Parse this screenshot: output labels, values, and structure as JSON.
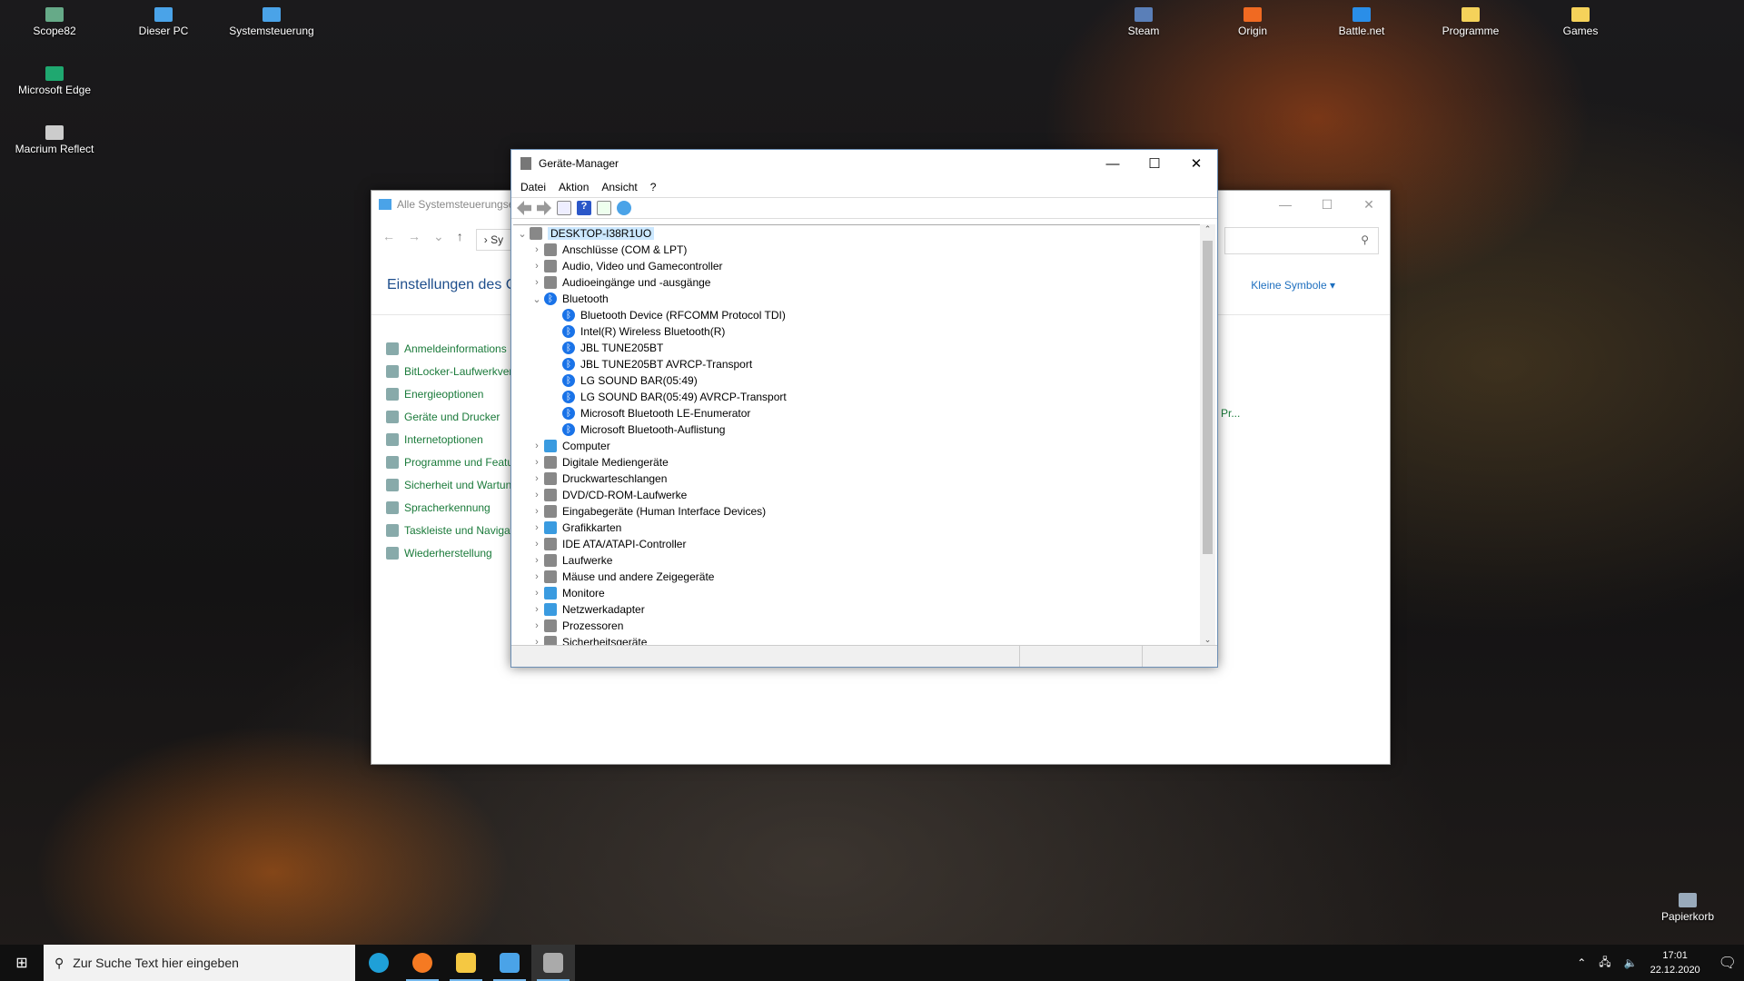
{
  "desktop": {
    "icons": [
      {
        "label": "Scope82",
        "color": "#6a8"
      },
      {
        "label": "Dieser PC",
        "color": "#4aa3e8"
      },
      {
        "label": "Systemsteuerung",
        "color": "#4aa3e8"
      },
      {
        "label": "Microsoft Edge",
        "color": "#1fa870"
      },
      {
        "label": "Macrium Reflect",
        "color": "#ccc"
      },
      {
        "label": "Steam",
        "color": "#5a7fb8"
      },
      {
        "label": "Origin",
        "color": "#f06a22"
      },
      {
        "label": "Battle.net",
        "color": "#2a8ee8"
      },
      {
        "label": "Programme",
        "color": "#f5d25a"
      },
      {
        "label": "Games",
        "color": "#f5d25a"
      },
      {
        "label": "Papierkorb",
        "color": "#9ab"
      }
    ]
  },
  "control_panel": {
    "title": "Alle Systemsteuerungse",
    "breadcrumb": "Sy",
    "heading": "Einstellungen des C",
    "view_label": "Kleine Symbole",
    "search_placeholder": "",
    "links": [
      "Anmeldeinformations",
      "BitLocker-Laufwerkver",
      "Energieoptionen",
      "Geräte und Drucker",
      "Internetoptionen",
      "Programme und Featu",
      "Sicherheit und Wartun",
      "Spracherkennung",
      "Taskleiste und Navigat",
      "Wiederherstellung"
    ],
    "truncated_item": "Pr..."
  },
  "device_manager": {
    "title": "Geräte-Manager",
    "menu": [
      "Datei",
      "Aktion",
      "Ansicht",
      "?"
    ],
    "root": "DESKTOP-I38R1UO",
    "tree": [
      {
        "label": "Anschlüsse (COM & LPT)",
        "level": 1,
        "state": "collapsed",
        "icon": "port-icon"
      },
      {
        "label": "Audio, Video und Gamecontroller",
        "level": 1,
        "state": "collapsed",
        "icon": "speaker-icon"
      },
      {
        "label": "Audioeingänge und -ausgänge",
        "level": 1,
        "state": "collapsed",
        "icon": "speaker-icon"
      },
      {
        "label": "Bluetooth",
        "level": 1,
        "state": "expanded",
        "icon": "bluetooth-icon"
      },
      {
        "label": "Bluetooth Device (RFCOMM Protocol TDI)",
        "level": 2,
        "icon": "bluetooth-icon"
      },
      {
        "label": "Intel(R) Wireless Bluetooth(R)",
        "level": 2,
        "icon": "bluetooth-icon"
      },
      {
        "label": "JBL TUNE205BT",
        "level": 2,
        "icon": "bluetooth-icon"
      },
      {
        "label": "JBL TUNE205BT AVRCP-Transport",
        "level": 2,
        "icon": "bluetooth-icon"
      },
      {
        "label": "LG SOUND BAR(05:49)",
        "level": 2,
        "icon": "bluetooth-icon"
      },
      {
        "label": "LG SOUND BAR(05:49) AVRCP-Transport",
        "level": 2,
        "icon": "bluetooth-icon"
      },
      {
        "label": "Microsoft Bluetooth LE-Enumerator",
        "level": 2,
        "icon": "bluetooth-icon"
      },
      {
        "label": "Microsoft Bluetooth-Auflistung",
        "level": 2,
        "icon": "bluetooth-icon"
      },
      {
        "label": "Computer",
        "level": 1,
        "state": "collapsed",
        "icon": "monitor-icon"
      },
      {
        "label": "Digitale Mediengeräte",
        "level": 1,
        "state": "collapsed",
        "icon": "media-device-icon"
      },
      {
        "label": "Druckwarteschlangen",
        "level": 1,
        "state": "collapsed",
        "icon": "printer-icon"
      },
      {
        "label": "DVD/CD-ROM-Laufwerke",
        "level": 1,
        "state": "collapsed",
        "icon": "disc-drive-icon"
      },
      {
        "label": "Eingabegeräte (Human Interface Devices)",
        "level": 1,
        "state": "collapsed",
        "icon": "keyboard-icon"
      },
      {
        "label": "Grafikkarten",
        "level": 1,
        "state": "collapsed",
        "icon": "graphics-card-icon"
      },
      {
        "label": "IDE ATA/ATAPI-Controller",
        "level": 1,
        "state": "collapsed",
        "icon": "controller-icon"
      },
      {
        "label": "Laufwerke",
        "level": 1,
        "state": "collapsed",
        "icon": "drive-icon"
      },
      {
        "label": "Mäuse und andere Zeigegeräte",
        "level": 1,
        "state": "collapsed",
        "icon": "mouse-icon"
      },
      {
        "label": "Monitore",
        "level": 1,
        "state": "collapsed",
        "icon": "monitor-icon"
      },
      {
        "label": "Netzwerkadapter",
        "level": 1,
        "state": "collapsed",
        "icon": "network-icon"
      },
      {
        "label": "Prozessoren",
        "level": 1,
        "state": "collapsed",
        "icon": "processor-icon"
      },
      {
        "label": "Sicherheitsgeräte",
        "level": 1,
        "state": "collapsed",
        "icon": "security-device-icon"
      }
    ]
  },
  "taskbar": {
    "search_placeholder": "Zur Suche Text hier eingeben",
    "time": "17:01",
    "date": "22.12.2020",
    "apps": [
      {
        "name": "edge",
        "color": "#1fa0d8"
      },
      {
        "name": "firefox",
        "color": "#f57a22"
      },
      {
        "name": "explorer",
        "color": "#f5c842"
      },
      {
        "name": "control-panel",
        "color": "#4aa3e8"
      },
      {
        "name": "device-manager",
        "color": "#aaa"
      }
    ]
  }
}
